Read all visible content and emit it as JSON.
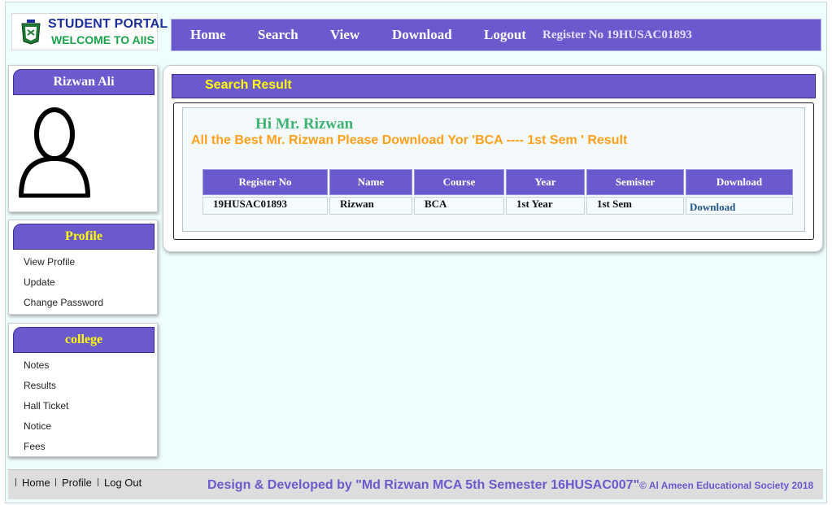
{
  "brand": {
    "title": "STUDENT PORTAL",
    "subtitle": "WELCOME TO AIIS"
  },
  "nav": {
    "items": [
      "Home",
      "Search",
      "View",
      "Download",
      "Logout"
    ],
    "register_text": "Register No 19HUSAC01893"
  },
  "profile_card": {
    "name": "Rizwan Ali",
    "avatar_icon": "user-icon"
  },
  "profile_menu": {
    "title": "Profile",
    "links": [
      "View Profile",
      "Update",
      "Change Password"
    ]
  },
  "college_menu": {
    "title": "college",
    "links": [
      "Notes",
      "Results",
      "Hall Ticket",
      "Notice",
      "Fees"
    ]
  },
  "result": {
    "bar_title": "Search Result",
    "greeting": "Hi Mr. Rizwan",
    "message": "All the Best Mr. Rizwan Please Download Yor 'BCA ---- 1st Sem ' Result",
    "headers": [
      "Register No",
      "Name",
      "Course",
      "Year",
      "Semister",
      "Download"
    ],
    "rows": [
      [
        "19HUSAC01893",
        "Rizwan",
        "BCA",
        "1st Year",
        "1st Sem",
        "Download"
      ]
    ]
  },
  "footer": {
    "links": [
      "Home",
      "Profile",
      "Log Out"
    ],
    "credit": "Design & Developed by \"Md Rizwan MCA 5th Semester 16HUSAC007\"",
    "copyright": "© Al Ameen Educational Society 2018"
  },
  "colors": {
    "accent": "#6a5acd",
    "heading_yellow": "#ffff00",
    "greeting_green": "#3cb371",
    "message_orange": "#ff9f1a",
    "background": "#eefdfd"
  }
}
